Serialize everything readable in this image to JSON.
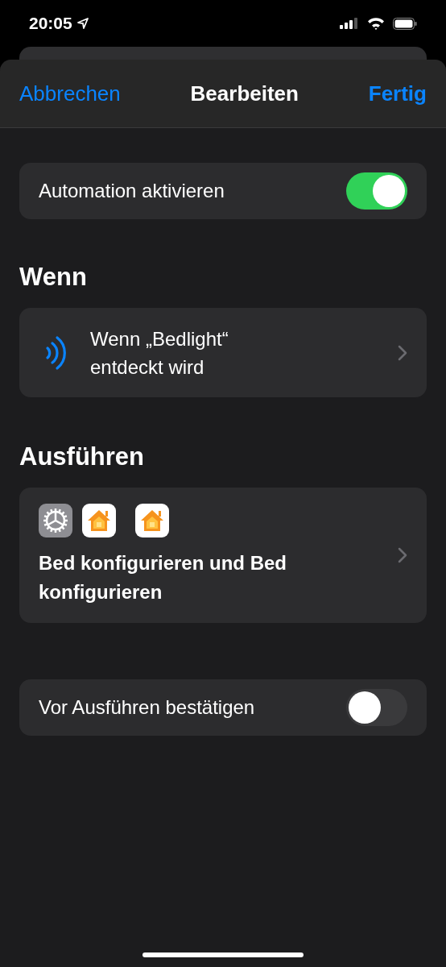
{
  "status_bar": {
    "time": "20:05"
  },
  "nav": {
    "cancel": "Abbrechen",
    "title": "Bearbeiten",
    "done": "Fertig"
  },
  "enable_row": {
    "label": "Automation aktivieren",
    "on": true
  },
  "trigger_section": {
    "heading": "Wenn",
    "text": "Wenn „Bedlight“ entdeckt wird"
  },
  "action_section": {
    "heading": "Ausführen",
    "apps": [
      {
        "kind": "settings"
      },
      {
        "kind": "home"
      },
      {
        "kind": "home"
      }
    ],
    "text": "Bed konfigurieren und Bed konfigurieren"
  },
  "confirm_row": {
    "label": "Vor Ausführen bestätigen",
    "on": false
  }
}
